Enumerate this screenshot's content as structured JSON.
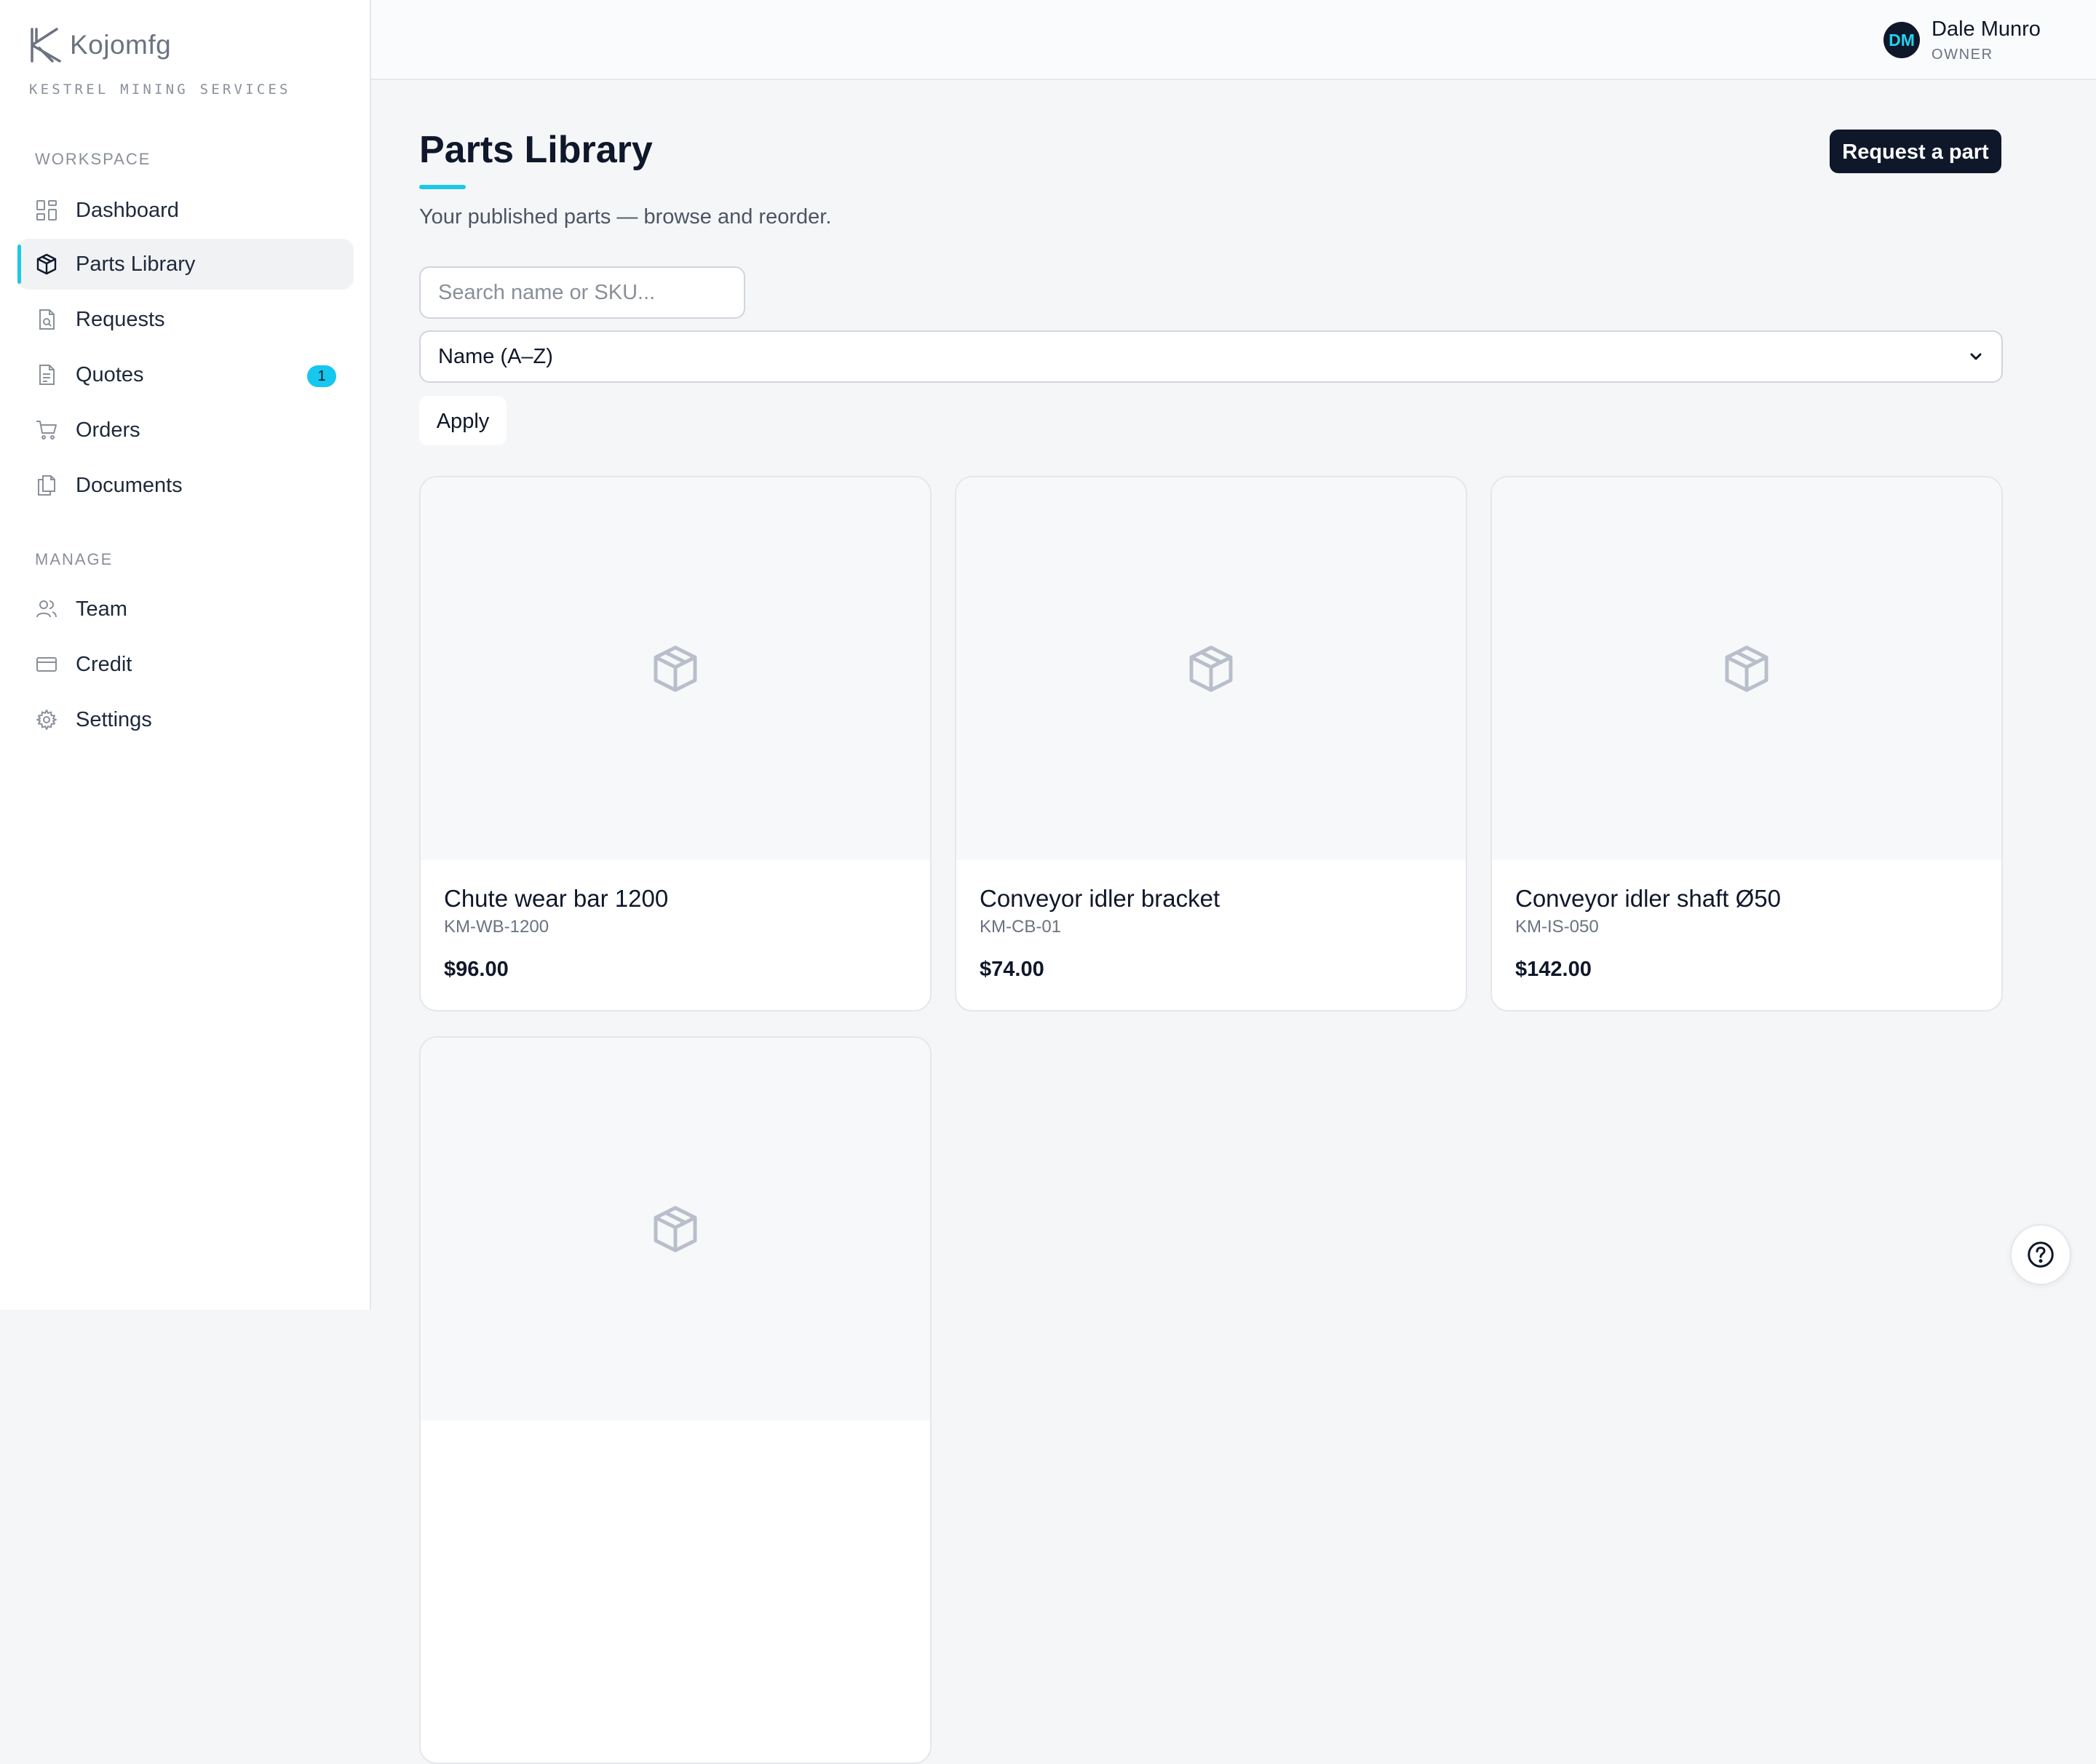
{
  "brand": {
    "name": "Kojomfg",
    "subtitle": "KESTREL MINING SERVICES"
  },
  "sidebar": {
    "workspace_label": "WORKSPACE",
    "manage_label": "MANAGE",
    "workspace_items": [
      {
        "label": "Dashboard",
        "icon": "dashboard-icon"
      },
      {
        "label": "Parts Library",
        "icon": "box-icon",
        "active": true
      },
      {
        "label": "Requests",
        "icon": "file-search-icon"
      },
      {
        "label": "Quotes",
        "icon": "document-icon",
        "badge": "1"
      },
      {
        "label": "Orders",
        "icon": "cart-icon"
      },
      {
        "label": "Documents",
        "icon": "files-icon"
      }
    ],
    "manage_items": [
      {
        "label": "Team",
        "icon": "users-icon"
      },
      {
        "label": "Credit",
        "icon": "credit-card-icon"
      },
      {
        "label": "Settings",
        "icon": "gear-icon"
      }
    ]
  },
  "user": {
    "initials": "DM",
    "name": "Dale Munro",
    "role": "OWNER"
  },
  "page": {
    "title": "Parts Library",
    "subtitle": "Your published parts — browse and reorder.",
    "request_button": "Request a part"
  },
  "filters": {
    "search_placeholder": "Search name or SKU...",
    "sort_value": "Name (A–Z)",
    "apply_label": "Apply"
  },
  "parts": [
    {
      "name": "Chute wear bar 1200",
      "sku": "KM-WB-1200",
      "price": "$96.00"
    },
    {
      "name": "Conveyor idler bracket",
      "sku": "KM-CB-01",
      "price": "$74.00"
    },
    {
      "name": "Conveyor idler shaft Ø50",
      "sku": "KM-IS-050",
      "price": "$142.00"
    }
  ],
  "colors": {
    "accent": "#1ec8e8",
    "dark": "#0f172a",
    "badge": "#16c7ee"
  }
}
